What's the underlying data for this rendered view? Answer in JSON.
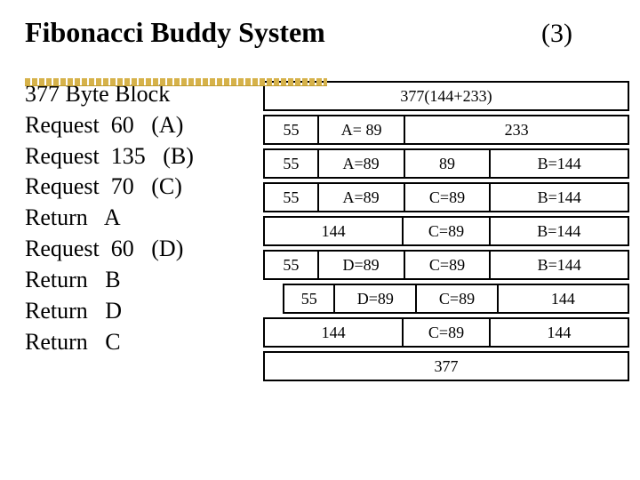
{
  "title": "Fibonacci Buddy System",
  "page_number": "(3)",
  "operations": [
    "377 Byte Block",
    "Request  60   (A)",
    "Request  135   (B)",
    "Request  70   (C)",
    "Return   A",
    "Request  60   (D)",
    "Return   B",
    "Return   D",
    "Return   C"
  ],
  "diagram_rows": [
    {
      "cells": [
        {
          "w": "w377",
          "label": "377(144+233)"
        }
      ]
    },
    {
      "cells": [
        {
          "w": "w55",
          "label": "55"
        },
        {
          "w": "w89",
          "label": "A= 89"
        },
        {
          "w": "w233",
          "label": "233"
        }
      ]
    },
    {
      "cells": [
        {
          "w": "w55",
          "label": "55"
        },
        {
          "w": "w89",
          "label": "A=89"
        },
        {
          "w": "w89",
          "label": "89"
        },
        {
          "w": "w144",
          "label": "B=144"
        }
      ]
    },
    {
      "cells": [
        {
          "w": "w55",
          "label": "55"
        },
        {
          "w": "w89",
          "label": "A=89"
        },
        {
          "w": "w89",
          "label": "C=89"
        },
        {
          "w": "w144",
          "label": "B=144"
        }
      ]
    },
    {
      "cells": [
        {
          "w": "w144",
          "label": "144"
        },
        {
          "w": "w89",
          "label": "C=89"
        },
        {
          "w": "w144",
          "label": "B=144"
        }
      ]
    },
    {
      "cells": [
        {
          "w": "w55",
          "label": "55"
        },
        {
          "w": "w89",
          "label": "D=89"
        },
        {
          "w": "w89",
          "label": "C=89"
        },
        {
          "w": "w144",
          "label": "B=144"
        }
      ]
    },
    {
      "offset": true,
      "cells": [
        {
          "w": "w55",
          "label": "55"
        },
        {
          "w": "w89",
          "label": "D=89"
        },
        {
          "w": "w89",
          "label": "C=89"
        },
        {
          "w": "w144",
          "label": "144"
        }
      ]
    },
    {
      "cells": [
        {
          "w": "w144",
          "label": "144"
        },
        {
          "w": "w89",
          "label": "C=89"
        },
        {
          "w": "w144",
          "label": "144"
        }
      ]
    },
    {
      "cells": [
        {
          "w": "w377",
          "label": "377"
        }
      ]
    }
  ],
  "chart_data": {
    "type": "table",
    "title": "Fibonacci Buddy System memory partition states (377-byte block)",
    "block_size": 377,
    "fibonacci_split": [
      144,
      233
    ],
    "operations_sequence": [
      "377 Byte Block",
      "Request 60 (A)",
      "Request 135 (B)",
      "Request 70 (C)",
      "Return A",
      "Request 60 (D)",
      "Return B",
      "Return D",
      "Return C"
    ],
    "states": [
      [
        {
          "size": 377,
          "label": "377(144+233)"
        }
      ],
      [
        {
          "size": 55
        },
        {
          "size": 89,
          "label": "A= 89"
        },
        {
          "size": 233
        }
      ],
      [
        {
          "size": 55
        },
        {
          "size": 89,
          "label": "A=89"
        },
        {
          "size": 89
        },
        {
          "size": 144,
          "label": "B=144"
        }
      ],
      [
        {
          "size": 55
        },
        {
          "size": 89,
          "label": "A=89"
        },
        {
          "size": 89,
          "label": "C=89"
        },
        {
          "size": 144,
          "label": "B=144"
        }
      ],
      [
        {
          "size": 144
        },
        {
          "size": 89,
          "label": "C=89"
        },
        {
          "size": 144,
          "label": "B=144"
        }
      ],
      [
        {
          "size": 55
        },
        {
          "size": 89,
          "label": "D=89"
        },
        {
          "size": 89,
          "label": "C=89"
        },
        {
          "size": 144,
          "label": "B=144"
        }
      ],
      [
        {
          "size": 55
        },
        {
          "size": 89,
          "label": "D=89"
        },
        {
          "size": 89,
          "label": "C=89"
        },
        {
          "size": 144
        }
      ],
      [
        {
          "size": 144
        },
        {
          "size": 89,
          "label": "C=89"
        },
        {
          "size": 144
        }
      ],
      [
        {
          "size": 377
        }
      ]
    ]
  }
}
